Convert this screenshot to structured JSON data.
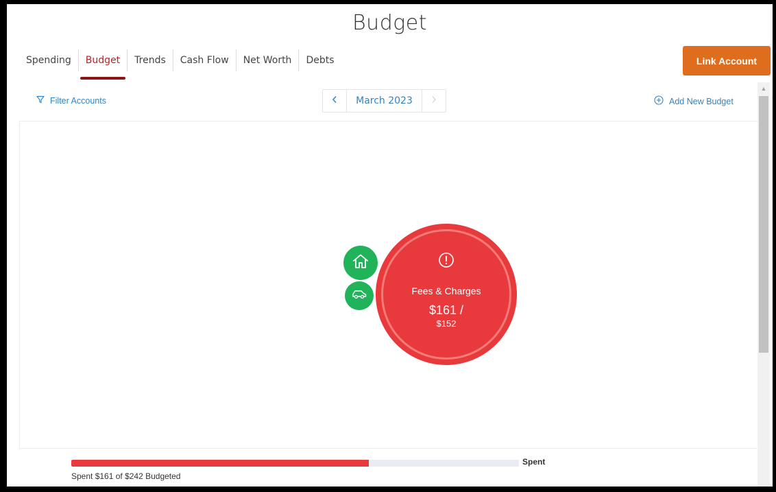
{
  "page": {
    "title": "Budget"
  },
  "tabs": [
    {
      "label": "Spending",
      "active": false
    },
    {
      "label": "Budget",
      "active": true
    },
    {
      "label": "Trends",
      "active": false
    },
    {
      "label": "Cash Flow",
      "active": false
    },
    {
      "label": "Net Worth",
      "active": false
    },
    {
      "label": "Debts",
      "active": false
    }
  ],
  "header": {
    "link_account_label": "Link Account"
  },
  "toolbar": {
    "filter_label": "Filter Accounts",
    "filter_icon": "filter-icon",
    "month": "March 2023",
    "prev_icon": "chevron-left-icon",
    "next_icon": "chevron-right-icon",
    "add_budget_label": "Add New Budget",
    "add_icon": "plus-circle-icon"
  },
  "bubbles": {
    "main": {
      "category": "Fees & Charges",
      "spent": "$161 /",
      "budget": "$152",
      "icon": "alert-circle-icon",
      "color": "#e8393c"
    },
    "home": {
      "icon": "home-icon",
      "color": "#21b35a"
    },
    "auto": {
      "icon": "car-icon",
      "color": "#21b35a"
    }
  },
  "summary": {
    "spent_label": "Spent",
    "text": "Spent $161 of $242 Budgeted",
    "spent_fraction": 0.665,
    "fill_color": "#e8393c"
  },
  "colors": {
    "accent": "#2f86c4",
    "button": "#de6e1e",
    "active_tab": "#b0272a",
    "over_budget": "#e8393c",
    "under_budget": "#21b35a"
  }
}
